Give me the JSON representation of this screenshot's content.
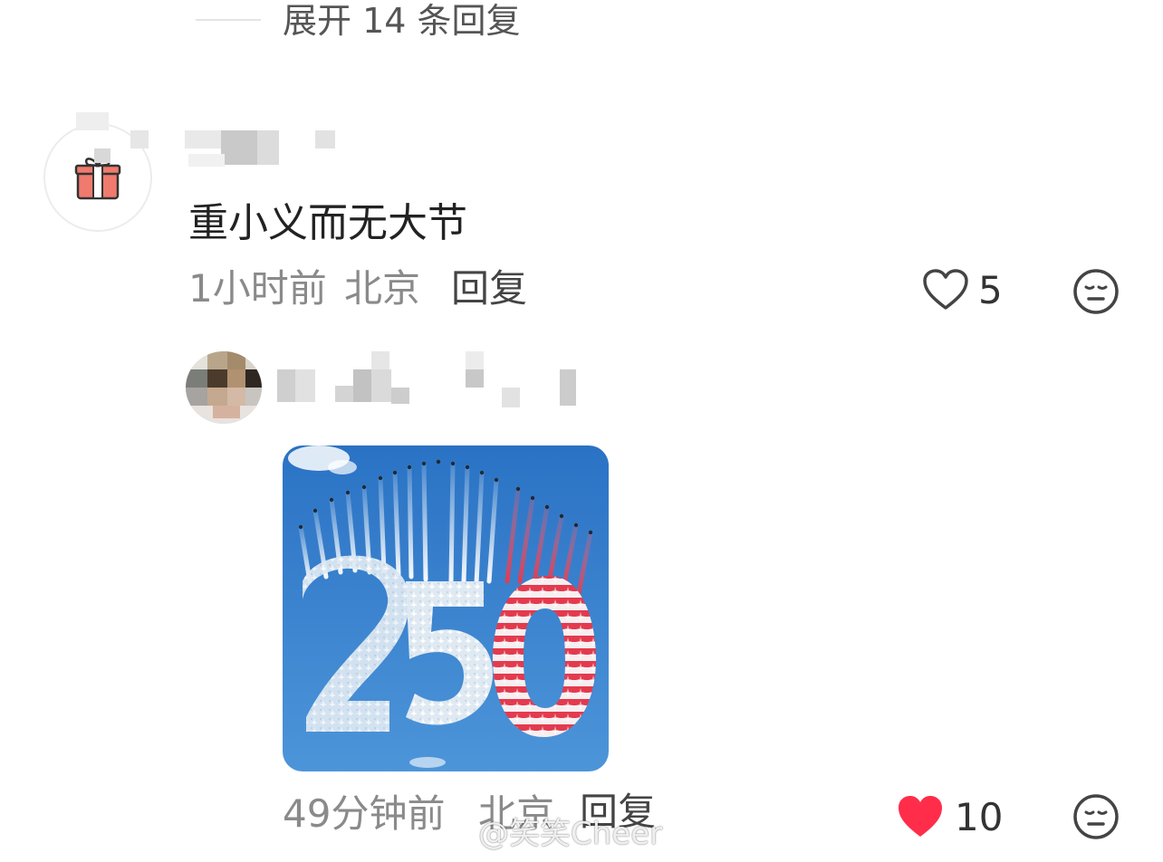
{
  "expand_replies": {
    "label": "展开 14 条回复"
  },
  "comment1": {
    "avatar_icon": "gift-icon",
    "text": "重小义而无大节",
    "time": "1小时前",
    "location": "北京",
    "reply_label": "回复",
    "like_count": "5",
    "liked": false,
    "react_icon": "neutral-face-icon"
  },
  "comment2": {
    "image": "250-jet-formation-photo",
    "time": "49分钟前",
    "location": "北京",
    "reply_label": "回复",
    "like_count": "10",
    "liked": true,
    "react_icon": "neutral-face-icon"
  },
  "colors": {
    "liked_heart": "#ff2d4a",
    "meta_gray": "#8a8a8a",
    "sky_blue": "#2a72c4"
  },
  "watermark": {
    "text": "@笑笑Cheer"
  }
}
